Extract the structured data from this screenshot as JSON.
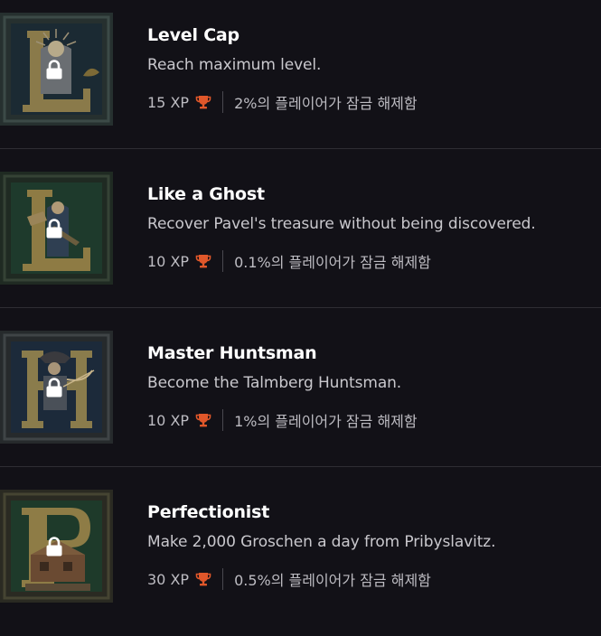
{
  "achievements": [
    {
      "title": "Level Cap",
      "description": "Reach maximum level.",
      "xp": "15 XP",
      "unlock_rate": "2%의 플레이어가 잠금 해제함",
      "letter": "L",
      "locked": true
    },
    {
      "title": "Like a Ghost",
      "description": "Recover Pavel's treasure without being discovered.",
      "xp": "10 XP",
      "unlock_rate": "0.1%의 플레이어가 잠금 해제함",
      "letter": "L",
      "locked": true
    },
    {
      "title": "Master Huntsman",
      "description": "Become the Talmberg Huntsman.",
      "xp": "10 XP",
      "unlock_rate": "1%의 플레이어가 잠금 해제함",
      "letter": "H",
      "locked": true
    },
    {
      "title": "Perfectionist",
      "description": "Make 2,000 Groschen a day from Pribyslavitz.",
      "xp": "30 XP",
      "unlock_rate": "0.5%의 플레이어가 잠금 해제함",
      "letter": "P",
      "locked": true
    }
  ],
  "icons": {
    "lock": "lock-icon",
    "trophy": "trophy-icon"
  },
  "colors": {
    "background": "#121117",
    "title": "#ffffff",
    "description": "#c9c8cd",
    "meta": "#bdbcc2",
    "trophy": "#e0572a",
    "divider": "#2e2d34"
  }
}
